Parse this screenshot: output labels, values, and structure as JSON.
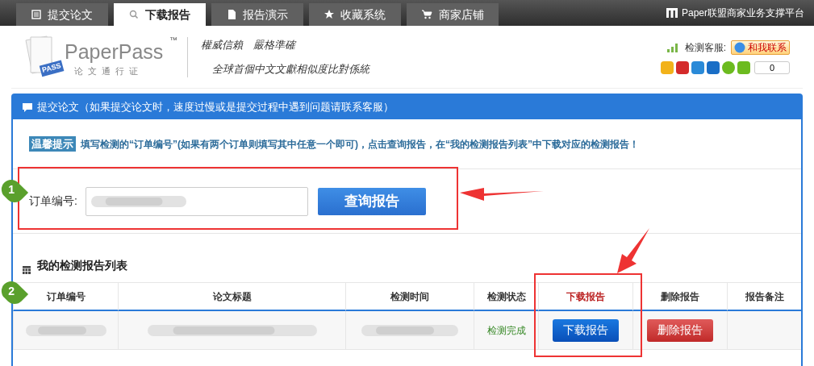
{
  "nav": {
    "tabs": [
      {
        "label": "提交论文",
        "kind": "list",
        "selected": false
      },
      {
        "label": "下载报告",
        "kind": "search",
        "selected": true
      },
      {
        "label": "报告演示",
        "kind": "file",
        "selected": false
      },
      {
        "label": "收藏系统",
        "kind": "star",
        "selected": false
      },
      {
        "label": "商家店铺",
        "kind": "cart",
        "selected": false
      }
    ],
    "platform": "Paper联盟商家业务支撑平台"
  },
  "header": {
    "logo": {
      "name": "PaperPass",
      "tm": "™",
      "subtitle": "论文通行证",
      "stamp": "PASS"
    },
    "slogan_1": "權威信賴　嚴格準確",
    "slogan_2": "全球首個中文文獻相似度比對係統",
    "service_label": "检测客服:",
    "contact_button": "和我联系",
    "share_count": "0"
  },
  "panel": {
    "title": "提交论文（如果提交论文时，速度过慢或是提交过程中遇到问题请联系客服）",
    "tip_badge": "温馨提示",
    "tip": "填写检测的“订单编号”(如果有两个订单则填写其中任意一个即可)，点击查询报告，在“我的检测报告列表”中下载对应的检测报告！",
    "order_label": "订单编号:",
    "query_button": "查询报告",
    "list_title": "我的检测报告列表",
    "columns": [
      "订单编号",
      "论文标题",
      "检测时间",
      "检测状态",
      "下载报告",
      "删除报告",
      "报告备注"
    ],
    "rows": [
      {
        "status": "检测完成",
        "download": "下载报告",
        "delete": "删除报告"
      }
    ]
  },
  "annotations": {
    "markers": [
      "1",
      "2"
    ]
  }
}
